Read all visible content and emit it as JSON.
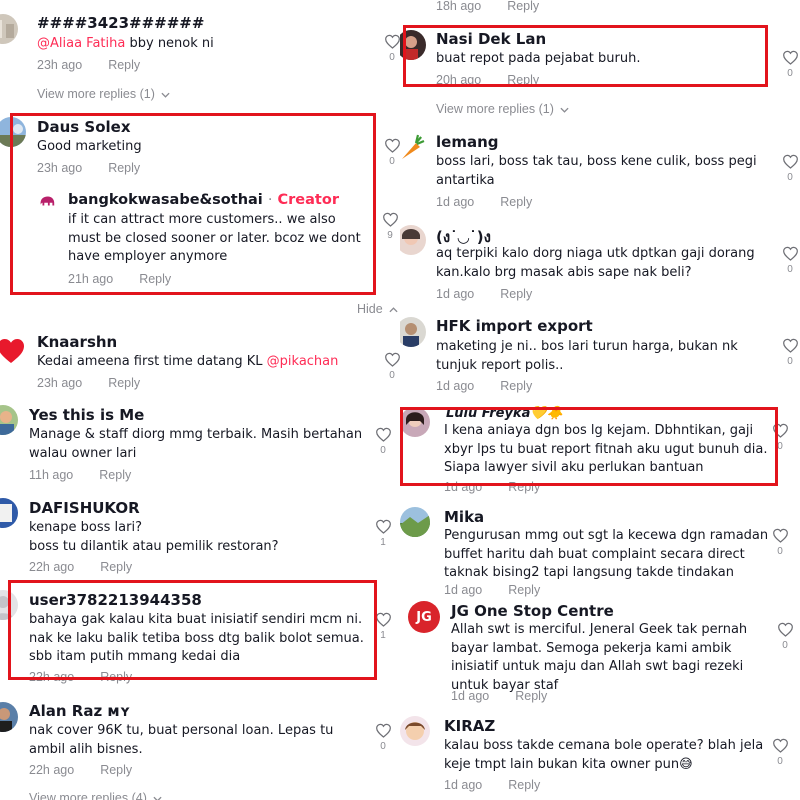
{
  "left": {
    "c1": {
      "username": "####3423######",
      "mention": "@Aliaa Fatiha",
      "text": " bby nenok ni",
      "time": "23h ago",
      "reply": "Reply",
      "likes": "0",
      "view_more": "View more replies (1)"
    },
    "c2": {
      "username": "Daus Solex",
      "text": "Good marketing",
      "time": "23h ago",
      "reply": "Reply",
      "likes": "0"
    },
    "c2r": {
      "username": "bangkokwasabe&sothai",
      "separator": "·",
      "badge": "Creator",
      "text": "if it can attract more customers.. we also must be closed sooner or later. bcoz we dont have employer anymore",
      "time": "21h ago",
      "reply": "Reply",
      "likes": "9",
      "hide": "Hide"
    },
    "c3": {
      "username": "Knaarshn",
      "text": "Kedai ameena first time datang KL ",
      "mention": "@pikachan",
      "time": "23h ago",
      "reply": "Reply",
      "likes": "0"
    },
    "c4": {
      "username": "Yes this is Me",
      "text": "Manage & staff diorg mmg terbaik. Masih bertahan walau owner lari",
      "time": "11h ago",
      "reply": "Reply",
      "likes": "0"
    },
    "c5": {
      "username": "DAFISHUKOR",
      "text_lines": [
        "kenape boss lari?",
        "boss tu dilantik atau pemilik restoran?"
      ],
      "time": "22h ago",
      "reply": "Reply",
      "likes": "1"
    },
    "c6": {
      "username": "user3782213944358",
      "text": "bahaya gak kalau kita buat inisiatif sendiri mcm ni. nak ke laku balik tetiba boss dtg balik bolot semua. sbb itam putih mmang kedai dia",
      "time": "22h ago",
      "reply": "Reply",
      "likes": "1"
    },
    "c7": {
      "username": "Alan Raz ᴍʏ",
      "text": "nak cover 96K tu, buat personal loan. Lepas tu ambil alih bisnes.",
      "time": "22h ago",
      "reply": "Reply",
      "likes": "0",
      "view_more": "View more replies (4)"
    }
  },
  "right": {
    "top": {
      "time": "18h ago",
      "reply": "Reply"
    },
    "c1": {
      "username": "Nasi Dek Lan",
      "text": "buat repot pada pejabat buruh.",
      "time": "20h ago",
      "reply": "Reply",
      "likes": "0",
      "view_more": "View more replies (1)"
    },
    "c2": {
      "username": "lemang",
      "text": "boss lari, boss tak tau, boss kene culik, boss pegi antartika",
      "time": "1d ago",
      "reply": "Reply",
      "likes": "0"
    },
    "c3": {
      "username": "(ง˙◡˙)ง",
      "text": "aq terpiki kalo dorg niaga utk dptkan gaji dorang kan.kalo brg masak abis sape nak beli?",
      "time": "1d ago",
      "reply": "Reply",
      "likes": "0"
    },
    "c4": {
      "username": "HFK import export",
      "text": "maketing je ni.. bos lari turun harga, bukan nk tunjuk report polis..",
      "time": "1d ago",
      "reply": "Reply",
      "likes": "0"
    },
    "c5": {
      "username": "Lulu Freyka",
      "emoji": "💛🐥",
      "text": "I kena aniaya dgn bos lg kejam. Dbhntikan, gaji xbyr lps tu buat report fitnah aku ugut bunuh dia. Siapa lawyer sivil aku perlukan bantuan",
      "time": "1d ago",
      "reply": "Reply",
      "likes": "0"
    },
    "c6": {
      "username": "Mika",
      "text": "Pengurusan mmg out sgt la kecewa dgn ramadan buffet haritu dah buat complaint secara direct taknak bising2 tapi langsung takde tindakan",
      "time": "1d ago",
      "reply": "Reply",
      "likes": "0"
    },
    "c7": {
      "username": "JG One Stop Centre",
      "avatar_text": "JG",
      "text": "Allah swt is merciful. Jeneral Geek tak pernah bayar lambat. Semoga pekerja kami ambik inisiatif untuk maju dan Allah swt bagi rezeki untuk bayar staf",
      "time": "1d ago",
      "reply": "Reply",
      "likes": "0"
    },
    "c8": {
      "username": "KIRAZ",
      "text": "kalau boss takde cemana bole operate? blah jela keje tmpt lain bukan kita owner pun😅",
      "time": "1d ago",
      "reply": "Reply",
      "likes": "0"
    }
  },
  "colors": {
    "accent": "#fe2c55",
    "highlight": "#e2141c",
    "meta": "#8a8b91",
    "text": "#161823"
  },
  "icons": [
    "heart-outline-icon",
    "chevron-down-icon",
    "chevron-up-icon",
    "red-heart-icon"
  ]
}
